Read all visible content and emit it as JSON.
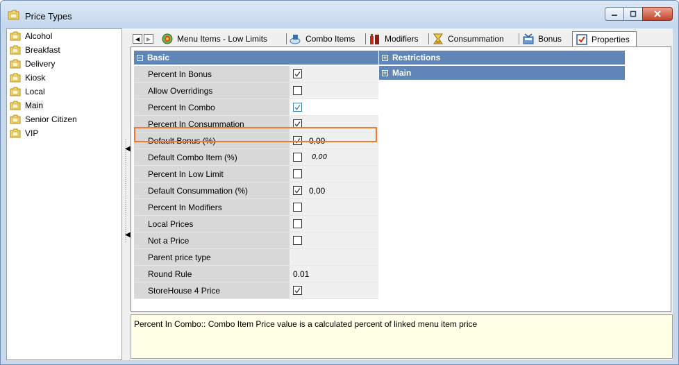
{
  "window": {
    "title": "Price Types",
    "controls": [
      "minimize",
      "maximize",
      "close"
    ]
  },
  "tree": {
    "items": [
      {
        "label": "Alcohol"
      },
      {
        "label": "Breakfast"
      },
      {
        "label": "Delivery"
      },
      {
        "label": "Kiosk"
      },
      {
        "label": "Local"
      },
      {
        "label": "Main",
        "selected": true
      },
      {
        "label": "Senior Citizen"
      },
      {
        "label": "VIP"
      }
    ]
  },
  "tabs": {
    "items": [
      {
        "label": "Menu Items - Low Limits",
        "icon": "menu-items-icon"
      },
      {
        "label": "Combo Items",
        "icon": "combo-icon"
      },
      {
        "label": "Modifiers",
        "icon": "modifiers-icon"
      },
      {
        "label": "Consummation",
        "icon": "consummation-icon"
      },
      {
        "label": "Bonus",
        "icon": "bonus-icon"
      },
      {
        "label": "Properties",
        "icon": "properties-icon",
        "active": true
      }
    ]
  },
  "groups": {
    "basic": "Basic",
    "restrictions": "Restrictions",
    "main": "Main"
  },
  "properties": [
    {
      "name": "Percent In Bonus",
      "checked": true
    },
    {
      "name": "Allow Overridings",
      "checked": false
    },
    {
      "name": "Percent In Combo",
      "checked": true,
      "highlighted": true
    },
    {
      "name": "Percent In Consummation",
      "checked": true
    },
    {
      "name": "Default Bonus (%)",
      "checked": true,
      "value": "0,00"
    },
    {
      "name": "Default Combo Item (%)",
      "checked": false,
      "value": "0,00",
      "value_style": "italic"
    },
    {
      "name": "Percent In Low Limit",
      "checked": false
    },
    {
      "name": "Default Consummation (%)",
      "checked": true,
      "value": "0,00"
    },
    {
      "name": "Percent In Modifiers",
      "checked": false
    },
    {
      "name": "Local Prices",
      "checked": false
    },
    {
      "name": "Not a Price",
      "checked": false
    },
    {
      "name": "Parent price type",
      "text": ""
    },
    {
      "name": "Round Rule",
      "text": "0.01"
    },
    {
      "name": "StoreHouse 4 Price",
      "checked": true
    }
  ],
  "status": {
    "text": "Percent In Combo:: Combo Item Price value is a calculated percent of linked menu item price"
  },
  "colors": {
    "group_header": "#5f86b7",
    "highlight": "#f07b2c",
    "status_bg": "#ffffe6"
  }
}
